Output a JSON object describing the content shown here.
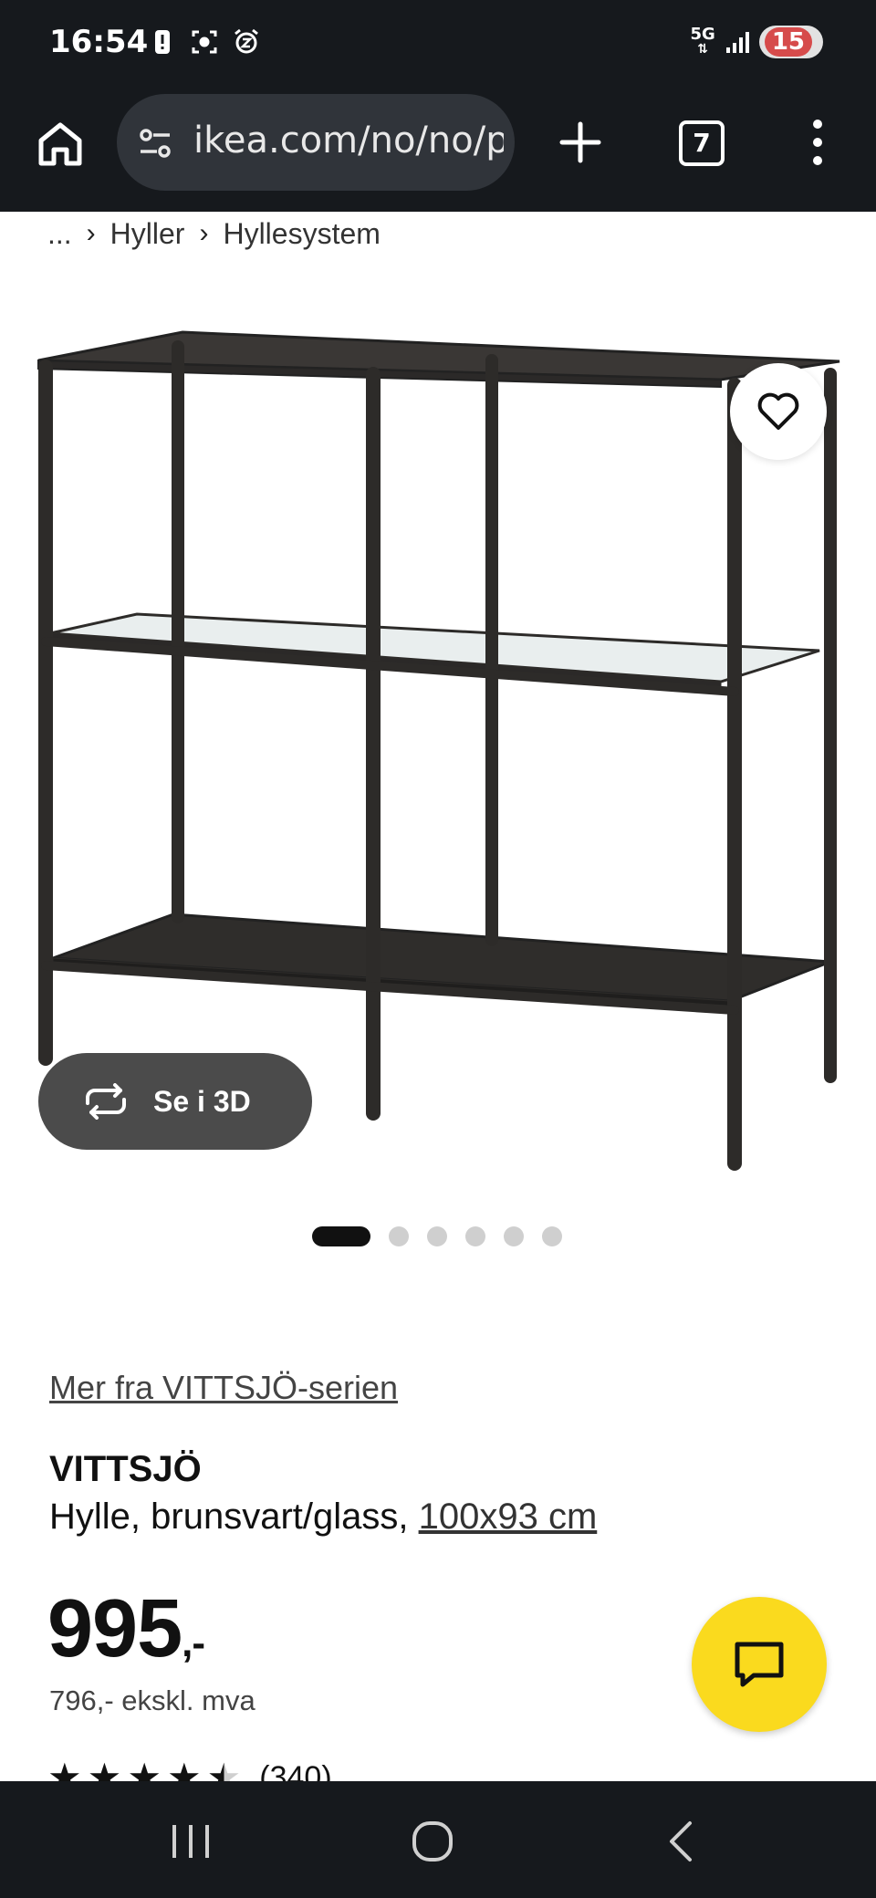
{
  "status_bar": {
    "time": "16:54",
    "network": "5G",
    "battery_level": "15",
    "icons": [
      "alert-icon",
      "screenshot-icon",
      "alarm-icon",
      "signal-icon"
    ]
  },
  "browser": {
    "url": "ikea.com/no/no/p",
    "tab_count": "7"
  },
  "breadcrumb": {
    "ellipsis": "...",
    "items": [
      "Hyller",
      "Hyllesystem"
    ]
  },
  "product": {
    "view_3d_label": "Se i 3D",
    "carousel": {
      "total": 6,
      "active_index": 0
    },
    "series_link": "Mer fra VITTSJÖ-serien",
    "name": "VITTSJÖ",
    "description": "Hylle, brunsvart/glass, ",
    "size_link": "100x93 cm",
    "price": "995",
    "price_suffix": ",-",
    "price_excl_vat": "796,- ekskl. mva",
    "rating_stars": 4.5,
    "review_count": "(340)"
  },
  "colors": {
    "system_bar": "#16191d",
    "url_pill": "#30343a",
    "chat_fab": "#fada1e",
    "button_3d": "#4b4b4b"
  }
}
